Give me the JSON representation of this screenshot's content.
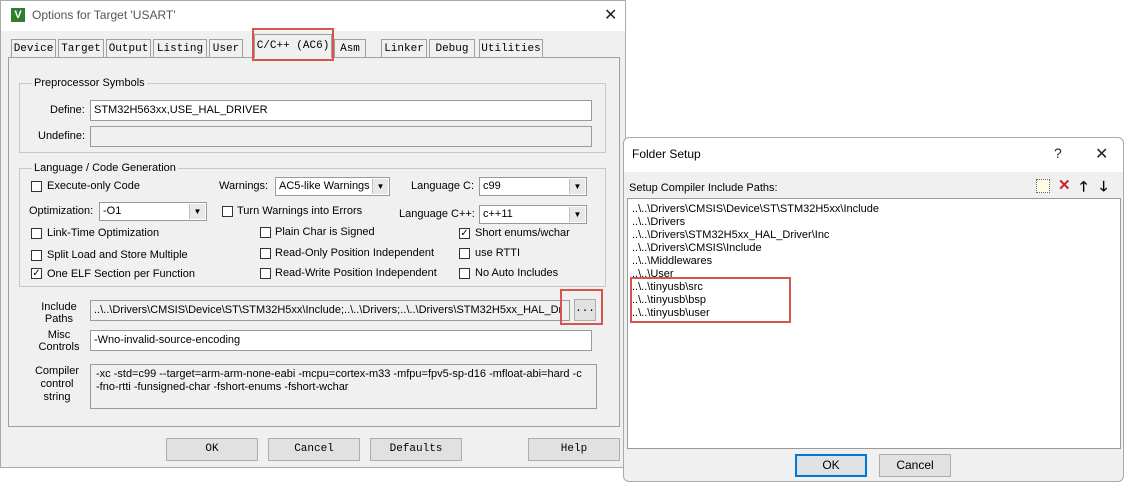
{
  "options_dialog": {
    "title": "Options for Target 'USART'",
    "app_icon": "keil-icon",
    "close_glyph": "✕",
    "tabs": [
      {
        "label": "Device"
      },
      {
        "label": "Target"
      },
      {
        "label": "Output"
      },
      {
        "label": "Listing"
      },
      {
        "label": "User"
      },
      {
        "label": "C/C++ (AC6)"
      },
      {
        "label": "Asm"
      },
      {
        "label": "Linker"
      },
      {
        "label": "Debug"
      },
      {
        "label": "Utilities"
      }
    ],
    "active_tab": "C/C++ (AC6)",
    "preprocessor": {
      "group_label": "Preprocessor Symbols",
      "define_label": "Define:",
      "define_value": "STM32H563xx,USE_HAL_DRIVER",
      "undefine_label": "Undefine:",
      "undefine_value": ""
    },
    "language": {
      "group_label": "Language / Code Generation",
      "execute_only_label": "Execute-only Code",
      "optimization_label": "Optimization:",
      "optimization_value": "-O1",
      "lto_label": "Link-Time Optimization",
      "split_label": "Split Load and Store Multiple",
      "one_elf_label": "One ELF Section per Function",
      "warnings_label": "Warnings:",
      "warnings_value": "AC5-like Warnings",
      "turn_warnings_label": "Turn Warnings into Errors",
      "plain_char_label": "Plain Char is Signed",
      "ropi_label": "Read-Only Position Independent",
      "rwpi_label": "Read-Write Position Independent",
      "lang_c_label": "Language C:",
      "lang_c_value": "c99",
      "lang_cpp_label": "Language C++:",
      "lang_cpp_value": "c++11",
      "short_enums_label": "Short enums/wchar",
      "use_rtti_label": "use RTTI",
      "no_auto_label": "No Auto Includes"
    },
    "include_label_1": "Include",
    "include_label_2": "Paths",
    "include_value": "..\\..\\Drivers\\CMSIS\\Device\\ST\\STM32H5xx\\Include;..\\..\\Drivers;..\\..\\Drivers\\STM32H5xx_HAL_Dr",
    "browse_label": "...",
    "misc_label_1": "Misc",
    "misc_label_2": "Controls",
    "misc_value": "-Wno-invalid-source-encoding",
    "compiler_label_1": "Compiler",
    "compiler_label_2": "control",
    "compiler_label_3": "string",
    "compiler_line_1": "-xc -std=c99 --target=arm-arm-none-eabi -mcpu=cortex-m33 -mfpu=fpv5-sp-d16 -mfloat-abi=hard -c",
    "compiler_line_2": "-fno-rtti -funsigned-char -fshort-enums -fshort-wchar",
    "buttons": {
      "ok": "OK",
      "cancel": "Cancel",
      "defaults": "Defaults",
      "help": "Help"
    }
  },
  "folder_dialog": {
    "title": "Folder Setup",
    "help_glyph": "?",
    "close_glyph": "✕",
    "list_header": "Setup Compiler Include Paths:",
    "toolbar_icons": [
      "new-folder-icon",
      "delete-icon",
      "move-up-icon",
      "move-down-icon"
    ],
    "paths": [
      "..\\..\\Drivers\\CMSIS\\Device\\ST\\STM32H5xx\\Include",
      "..\\..\\Drivers",
      "..\\..\\Drivers\\STM32H5xx_HAL_Driver\\Inc",
      "..\\..\\Drivers\\CMSIS\\Include",
      "..\\..\\Middlewares",
      "..\\..\\User",
      "..\\..\\tinyusb\\src",
      "..\\..\\tinyusb\\bsp",
      "..\\..\\tinyusb\\user"
    ],
    "buttons": {
      "ok": "OK",
      "cancel": "Cancel"
    }
  },
  "highlight_color": "#d9534f"
}
